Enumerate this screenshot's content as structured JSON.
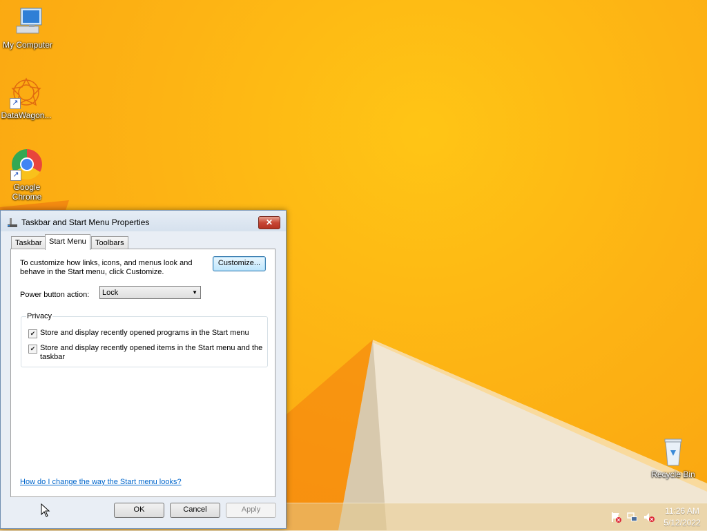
{
  "desktop": {
    "icons": [
      {
        "label": "My Computer",
        "icon": "computer-icon"
      },
      {
        "label": "DataWagon...",
        "icon": "datawagon-icon"
      },
      {
        "label": "Google Chrome",
        "icon": "chrome-icon"
      },
      {
        "label": "Recycle Bin",
        "icon": "recycle-bin-icon"
      }
    ]
  },
  "dialog": {
    "title": "Taskbar and Start Menu Properties",
    "close": "✕",
    "tabs": [
      "Taskbar",
      "Start Menu",
      "Toolbars"
    ],
    "active_tab": "Start Menu",
    "description": "To customize how links, icons, and menus look and behave in the Start menu, click Customize.",
    "customize_button": "Customize...",
    "power_label": "Power button action:",
    "power_value": "Lock",
    "privacy_legend": "Privacy",
    "checkboxes": [
      {
        "label": "Store and display recently opened programs in the Start menu",
        "checked": true
      },
      {
        "label": "Store and display recently opened items in the Start menu and the taskbar",
        "checked": true
      }
    ],
    "help_link": "How do I change the way the Start menu looks?",
    "ok": "OK",
    "cancel": "Cancel",
    "apply": "Apply"
  },
  "taskbar": {
    "time": "11:26 AM",
    "date": "5/12/2022",
    "tray_icons": [
      "action-center-flag-icon",
      "network-icon",
      "volume-muted-icon"
    ]
  },
  "colors": {
    "wallpaper": "#fdb314",
    "dialog_bg": "#e9eef5",
    "close_button": "#c74634",
    "link": "#0066cc"
  }
}
